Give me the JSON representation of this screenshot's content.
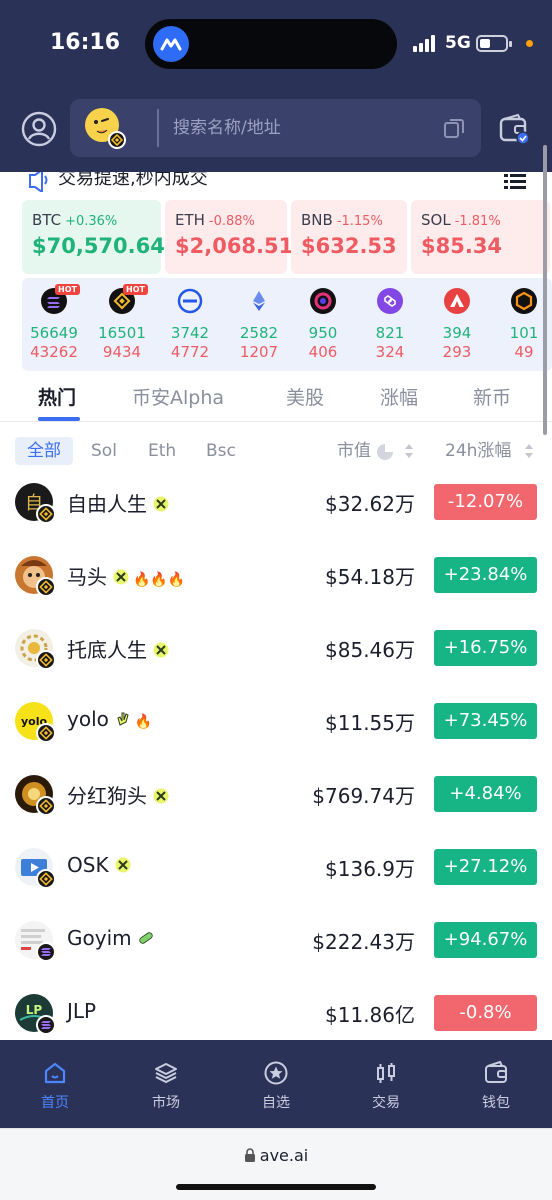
{
  "status_bar": {
    "time": "16:16",
    "network": "5G"
  },
  "search": {
    "placeholder": "搜索名称/地址"
  },
  "notice": {
    "text": "交易提速,秒内成交"
  },
  "tickers": [
    {
      "symbol": "BTC",
      "change": "+0.36%",
      "price": "$70,570.64",
      "direction": "up"
    },
    {
      "symbol": "ETH",
      "change": "-0.88%",
      "price": "$2,068.51",
      "direction": "down"
    },
    {
      "symbol": "BNB",
      "change": "-1.15%",
      "price": "$632.53",
      "direction": "down"
    },
    {
      "symbol": "SOL",
      "change": "-1.81%",
      "price": "$85.34",
      "direction": "down"
    }
  ],
  "chain_stats": [
    {
      "icon": "solana-icon",
      "hot": "HOT",
      "up": "56649",
      "down": "43262"
    },
    {
      "icon": "bnb-icon",
      "hot": "HOT",
      "up": "16501",
      "down": "9434"
    },
    {
      "icon": "base-icon",
      "up": "3742",
      "down": "4772"
    },
    {
      "icon": "ethereum-icon",
      "up": "2582",
      "down": "1207"
    },
    {
      "icon": "monad-icon",
      "up": "950",
      "down": "406"
    },
    {
      "icon": "polygon-icon",
      "up": "821",
      "down": "324"
    },
    {
      "icon": "avalanche-icon",
      "up": "394",
      "down": "293"
    },
    {
      "icon": "core-icon",
      "up": "101",
      "down": "49"
    }
  ],
  "tabs": [
    "热门",
    "币安Alpha",
    "美股",
    "涨幅",
    "新币"
  ],
  "filters": {
    "chips": [
      "全部",
      "Sol",
      "Eth",
      "Bsc"
    ],
    "market_cap_label": "市值",
    "change_label": "24h涨幅"
  },
  "tokens": [
    {
      "name": "自由人生",
      "tags": "",
      "market_cap": "$32.62万",
      "change": "-12.07%",
      "direction": "down",
      "chain": "bnb"
    },
    {
      "name": "马头",
      "tags": "🔥🔥🔥",
      "market_cap": "$54.18万",
      "change": "+23.84%",
      "direction": "up",
      "chain": "bnb"
    },
    {
      "name": "托底人生",
      "tags": "",
      "market_cap": "$85.46万",
      "change": "+16.75%",
      "direction": "up",
      "chain": "bnb"
    },
    {
      "name": "yolo",
      "tags": "🔥",
      "market_cap": "$11.55万",
      "change": "+73.45%",
      "direction": "up",
      "chain": "bnb"
    },
    {
      "name": "分红狗头",
      "tags": "",
      "market_cap": "$769.74万",
      "change": "+4.84%",
      "direction": "up",
      "chain": "bnb"
    },
    {
      "name": "OSK",
      "tags": "",
      "market_cap": "$136.9万",
      "change": "+27.12%",
      "direction": "up",
      "chain": "bnb"
    },
    {
      "name": "Goyim",
      "tags": "",
      "market_cap": "$222.43万",
      "change": "+94.67%",
      "direction": "up",
      "chain": "solana"
    },
    {
      "name": "JLP",
      "tags": "",
      "market_cap": "$11.86亿",
      "change": "-0.8%",
      "direction": "down",
      "chain": "solana"
    }
  ],
  "bottom_nav": [
    {
      "label": "首页",
      "icon": "home-icon",
      "active": true
    },
    {
      "label": "市场",
      "icon": "layers-icon"
    },
    {
      "label": "自选",
      "icon": "star-icon"
    },
    {
      "label": "交易",
      "icon": "candlestick-icon"
    },
    {
      "label": "钱包",
      "icon": "wallet-icon"
    }
  ],
  "browser": {
    "url": "ave.ai"
  },
  "colors": {
    "header_bg": "#2b3257",
    "up": "#17b485",
    "down": "#f2666e",
    "accent": "#3b6ef0"
  }
}
